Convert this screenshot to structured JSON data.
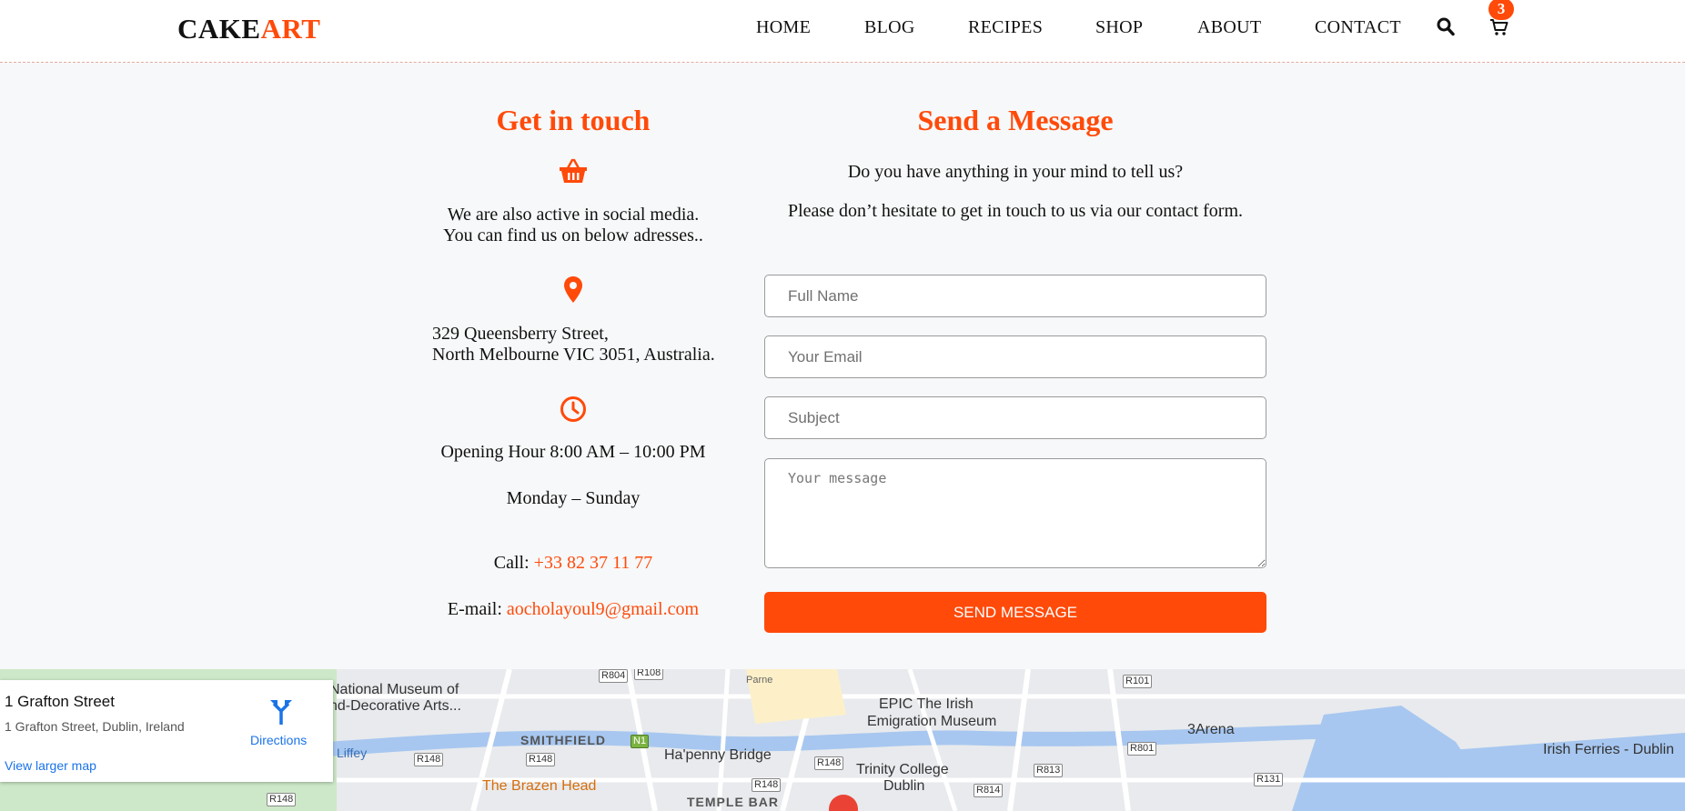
{
  "header": {
    "logo_part1": "CAKE",
    "logo_part2": "ART",
    "nav": [
      "HOME",
      "BLOG",
      "RECIPES",
      "SHOP",
      "ABOUT",
      "CONTACT"
    ],
    "cart_count": "3"
  },
  "contact": {
    "title": "Get in touch",
    "social_line1": "We are also active in social media.",
    "social_line2": "You can find us on below adresses..",
    "address_line1": "329 Queensberry Street,",
    "address_line2": "North Melbourne VIC 3051, Australia.",
    "hours": "Opening Hour 8:00 AM – 10:00 PM",
    "days": "Monday – Sunday",
    "call_label": "Call: ",
    "phone": "+33 82 37 11 77",
    "email_label": "E-mail: ",
    "email": "aocholayoul9@gmail.com"
  },
  "form": {
    "title": "Send a Message",
    "intro1": "Do you have anything in your mind to tell us?",
    "intro2": "Please don’t hesitate to get in touch to us via our contact form.",
    "name_placeholder": "Full Name",
    "email_placeholder": "Your Email",
    "subject_placeholder": "Subject",
    "message_placeholder": "Your message",
    "submit_label": "SEND MESSAGE"
  },
  "map": {
    "place_title": "1 Grafton Street",
    "place_address": "1 Grafton Street, Dublin, Ireland",
    "directions_label": "Directions",
    "larger_map_label": "View larger map",
    "labels": [
      "National Museum of",
      "nd-Decorative Arts...",
      "EPIC The Irish",
      "Emigration Museum",
      "3Arena",
      "Irish Ferries - Dublin",
      "SMITHFIELD",
      "Ha'penny Bridge",
      "The Brazen Head",
      "Trinity College",
      "Dublin",
      "TEMPLE BAR",
      "Liffey",
      "Parne"
    ],
    "roads": [
      "R804",
      "R108",
      "R101",
      "R801",
      "R813",
      "R148",
      "R148",
      "R148",
      "R148",
      "R148",
      "R814",
      "R131",
      "N1"
    ],
    "colors": {
      "water": "#a7c7f0",
      "road": "#ffffff",
      "park": "#cde8c8",
      "land": "#e8eaed"
    }
  },
  "colors": {
    "accent": "#ff4a0a",
    "background": "#f7f8f9"
  }
}
